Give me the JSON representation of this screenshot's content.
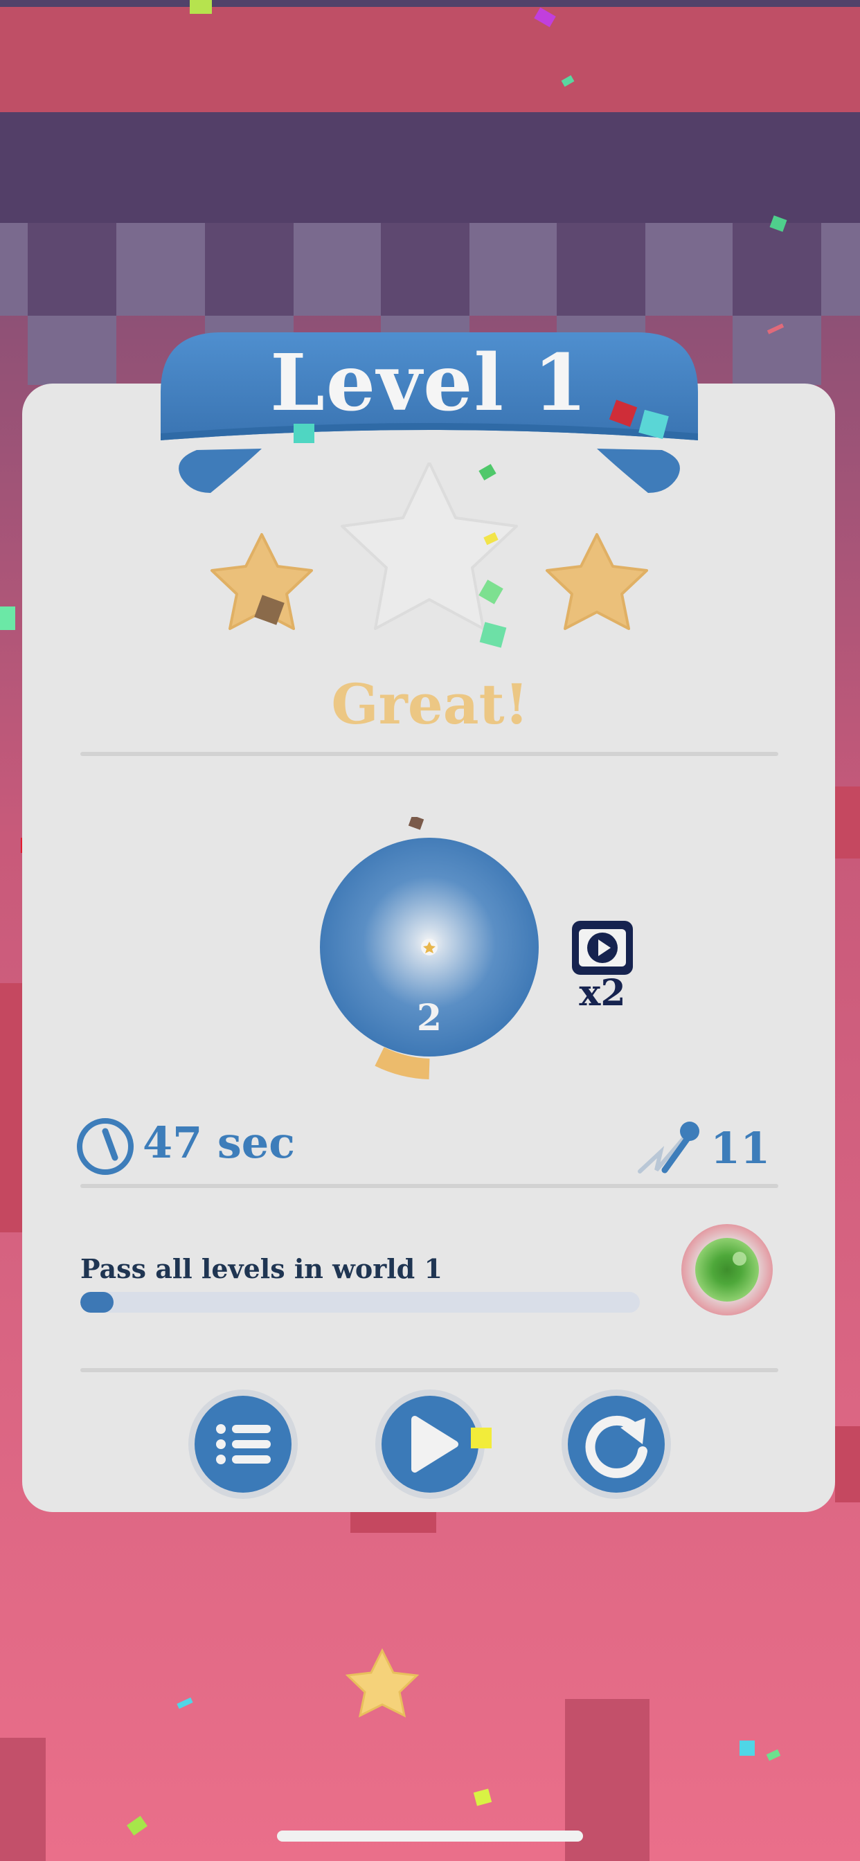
{
  "screen": {
    "title": "Level 1",
    "rating_text": "Great!",
    "stars_earned": 2,
    "stars_total": 3
  },
  "reward": {
    "count": "2",
    "video_multiplier": "x2"
  },
  "stats": {
    "time": "47 sec",
    "moves": "11"
  },
  "challenge": {
    "text": "Pass all levels in world 1",
    "progress": 0.06
  },
  "buttons": {
    "menu": "list-icon",
    "next": "play-icon",
    "retry": "restart-icon"
  },
  "colors": {
    "accent_blue": "#3b7ab8",
    "star_gold": "#ecc07a",
    "card_bg": "#e6e6e6",
    "title_text": "#f5f5f5"
  }
}
